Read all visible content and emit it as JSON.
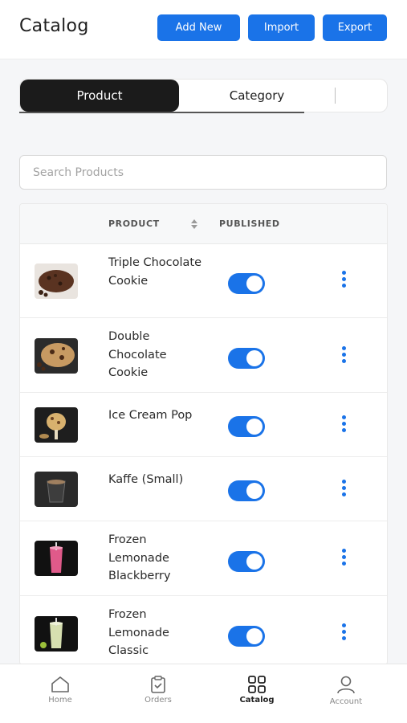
{
  "header": {
    "title": "Catalog",
    "add_new": "Add New",
    "import": "Import",
    "export": "Export"
  },
  "tabs": [
    {
      "label": "Product",
      "active": true
    },
    {
      "label": "Category",
      "active": false
    }
  ],
  "search": {
    "placeholder": "Search Products",
    "value": ""
  },
  "table": {
    "columns": {
      "product": "PRODUCT",
      "published": "PUBLISHED"
    },
    "rows": [
      {
        "name": "Triple Chocolate Cookie",
        "published": true,
        "image": "cookie-dark-image"
      },
      {
        "name": "Double Chocolate Cookie",
        "published": true,
        "image": "cookie-chip-image"
      },
      {
        "name": "Ice Cream Pop",
        "published": true,
        "image": "ice-cream-pop-image"
      },
      {
        "name": "Kaffe (Small)",
        "published": true,
        "image": "coffee-cup-image"
      },
      {
        "name": "Frozen Lemonade Blackberry",
        "published": true,
        "image": "blackberry-drink-image"
      },
      {
        "name": "Frozen Lemonade Classic",
        "published": true,
        "image": "classic-lemonade-image"
      }
    ]
  },
  "bottom_nav": [
    {
      "label": "Home",
      "icon": "home-icon",
      "active": false
    },
    {
      "label": "Orders",
      "icon": "orders-icon",
      "active": false
    },
    {
      "label": "Catalog",
      "icon": "catalog-grid-icon",
      "active": true
    },
    {
      "label": "Account",
      "icon": "account-icon",
      "active": false
    }
  ],
  "colors": {
    "accent": "#1a73e8",
    "active_tab": "#1b1b1b"
  }
}
